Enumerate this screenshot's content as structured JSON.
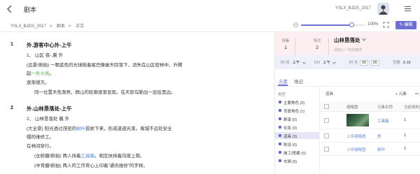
{
  "topbar": {
    "title": "剧本",
    "user_name": "YSLX_BJDS_2017"
  },
  "toolbar": {
    "breadcrumb": [
      "YSLX_BJDS_2017",
      "剧本",
      "正文"
    ],
    "zoom_label": "100%",
    "zoom_level": 1.0,
    "edit_label": "编辑"
  },
  "script": {
    "scenes": [
      {
        "number": "1",
        "heading": "外.游客中心外-上午",
        "meta": "1、 山区  夜-,晨  外",
        "lines": [
          {
            "parts": [
              {
                "t": "(远景/俯拍)  一颗蓝色的光球拖着尾巴像破天际落下，消失在山区密林中，升腾"
              }
            ]
          },
          {
            "parts": [
              {
                "t": "起",
                "c": ""
              },
              {
                "t": "一片火光",
                "c": "green"
              },
              {
                "t": "。",
                "c": ""
              }
            ]
          },
          {
            "parts": [
              {
                "t": "逐渐熄灭。"
              }
            ]
          },
          {
            "parts": [
              {
                "t": "同一位置天色渐亮，群山的轮廓逐渐显现，在天际勾勒出一层层黑边。"
              }
            ]
          }
        ]
      },
      {
        "number": "2",
        "heading": "外.山林垦落处-上午",
        "meta": "2、 山林垦落处  晨  外",
        "lines": [
          {
            "parts": [
              {
                "t": "(大全景)  阳光透过茂密的",
                "c": ""
              },
              {
                "t": "树叶",
                "c": "blue"
              },
              {
                "t": "投射下来，形成道道光束。离城不远处安全",
                "c": ""
              }
            ]
          },
          {
            "parts": [
              {
                "t": "帽的维修工。"
              }
            ]
          },
          {
            "parts": [
              {
                "t": "在林间穿行。"
              }
            ]
          },
          {
            "parts": [
              {
                "t": "(全俯摄/俯拍)  两人持着",
                "c": ""
              },
              {
                "t": "工具箱",
                "c": "blue"
              },
              {
                "t": "，相互扶持着向坡上爬。",
                "c": ""
              }
            ]
          },
          {
            "parts": [
              {
                "t": "(中背摄/俯拍)  两人的工作背心上印着\"通讯维修\"的字样。"
              }
            ]
          }
        ]
      }
    ]
  },
  "scene_panel": {
    "fields": [
      {
        "label": "场集",
        "value": "1"
      },
      {
        "label": "场次",
        "value": "2"
      }
    ],
    "scene_name": "山林垦落处",
    "hint": "请输入一句话描述",
    "attrs": {
      "time_label": "时  间",
      "time_value": "上午",
      "place_label": "DN",
      "place_value": "上午",
      "duration_label": "时  长",
      "duration_min": "00",
      "duration_sep": ":",
      "duration_sec": "00",
      "pages_label": "页数",
      "pages_value": "0.16"
    },
    "tabs": [
      "元素",
      "场记"
    ],
    "categories_title": "类型",
    "categories": [
      {
        "label": "主要角色 (0)"
      },
      {
        "label": "背景角色 (1)"
      },
      {
        "label": "群演 (0)"
      },
      {
        "label": "化妆 (0)"
      },
      {
        "label": "道具 (3)",
        "active": true
      },
      {
        "label": "陈设 (0)"
      },
      {
        "label": "施工/搭建 (0)"
      },
      {
        "label": "车辆 (0)"
      }
    ],
    "table": {
      "title": "道具",
      "add_label": "+ 元素",
      "link_label": "关联",
      "columns": [
        "缩略图",
        "元素名称",
        "当前场的数量"
      ],
      "rows": [
        {
          "name": "工具箱",
          "qty": "1",
          "thumb": "image"
        },
        {
          "name": "房",
          "qty": "1",
          "thumb": "上传缩略图"
        },
        {
          "name": "树叶",
          "qty": "1",
          "thumb": "上传缩略图"
        }
      ]
    }
  },
  "colors": {
    "accent": "#6c6fd6",
    "green": "#2ea52e",
    "blue": "#4a7fe0",
    "scene_bg": "#fdeef1"
  }
}
